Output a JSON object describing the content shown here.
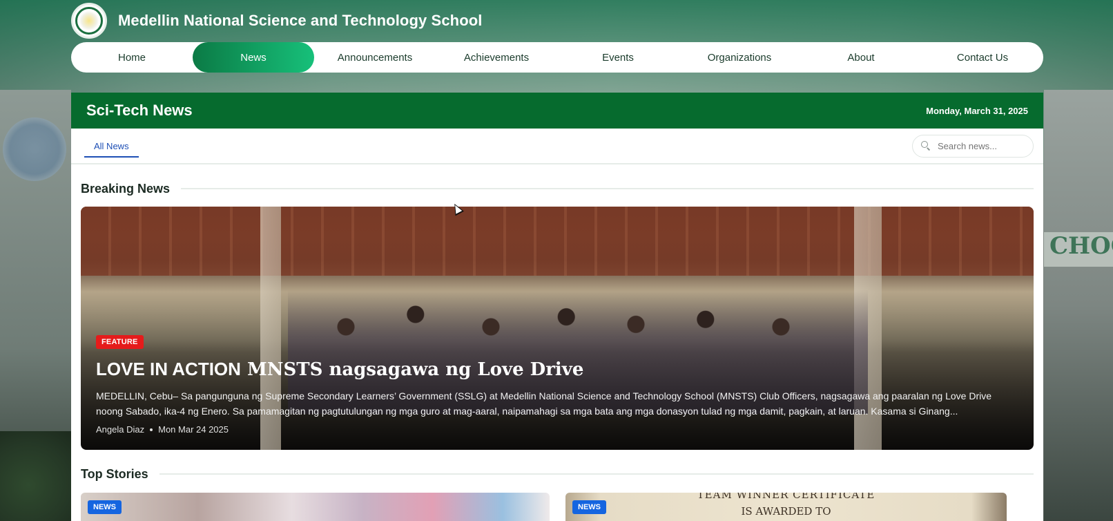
{
  "header": {
    "school_name": "Medellin National Science and Technology School"
  },
  "nav": {
    "items": [
      {
        "label": "Home",
        "active": false
      },
      {
        "label": "News",
        "active": true
      },
      {
        "label": "Announcements",
        "active": false
      },
      {
        "label": "Achievements",
        "active": false
      },
      {
        "label": "Events",
        "active": false
      },
      {
        "label": "Organizations",
        "active": false
      },
      {
        "label": "About",
        "active": false
      },
      {
        "label": "Contact Us",
        "active": false
      }
    ]
  },
  "panel": {
    "title": "Sci-Tech News",
    "date": "Monday, March 31, 2025"
  },
  "filters": {
    "active_tab": "All News",
    "search_placeholder": "Search news..."
  },
  "breaking": {
    "heading": "Breaking News",
    "badge": "FEATURE",
    "title_prefix": "LOVE IN ACTION",
    "title_rest": " MNSTS nagsagawa ng Love Drive",
    "excerpt": "MEDELLIN, Cebu– Sa pangunguna ng Supreme Secondary Learners’ Government (SSLG) at Medellin National Science and Technology School (MNSTS) Club Officers, nagsagawa ang paaralan ng Love Drive noong Sabado, ika-4 ng Enero. Sa pamamagitan ng pagtutulungan ng mga guro at mag-aaral, naipamahagi sa mga bata ang mga donasyon tulad ng mga damit, pagkain, at laruan. Kasama si Ginang...",
    "author": "Angela Diaz",
    "date": "Mon Mar 24 2025"
  },
  "top_stories": {
    "heading": "Top Stories",
    "cards": [
      {
        "badge": "NEWS"
      },
      {
        "badge": "NEWS",
        "image_text_1": "TEAM WINNER CERTIFICATE",
        "image_text_2": "IS AWARDED TO"
      }
    ]
  },
  "colors": {
    "brand_green": "#066b2e",
    "nav_active_start": "#0b7a45",
    "nav_active_end": "#17c07a",
    "feature_badge": "#e51b1b",
    "news_badge": "#1565e0",
    "tab_blue": "#1e4fb5"
  },
  "icons": {
    "search": "search-icon",
    "logo": "school-seal-logo"
  }
}
